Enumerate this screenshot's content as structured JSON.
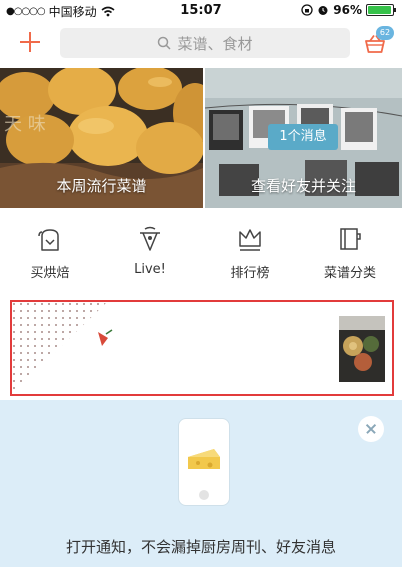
{
  "status_bar": {
    "signal_dots": "●○○○○",
    "carrier": "中国移动",
    "wifi_icon": "wifi-icon",
    "time": "15:07",
    "battery_percent": "96%",
    "battery_level": 0.96
  },
  "top_bar": {
    "search_placeholder": "菜谱、食材",
    "basket_badge": "62",
    "accent_color": "#f06a4a"
  },
  "banners": [
    {
      "caption": "本周流行菜谱"
    },
    {
      "caption": "查看好友并关注",
      "message_button": "1个消息"
    }
  ],
  "categories": [
    {
      "label": "买烘焙",
      "icon": "baking-icon"
    },
    {
      "label": "Live!",
      "icon": "live-icon"
    },
    {
      "label": "排行榜",
      "icon": "crown-icon"
    },
    {
      "label": "菜谱分类",
      "icon": "recipe-book-icon"
    }
  ],
  "notification": {
    "text": "打开通知，不会漏掉厨房周刊、好友消息",
    "background": "#dcedf8"
  }
}
